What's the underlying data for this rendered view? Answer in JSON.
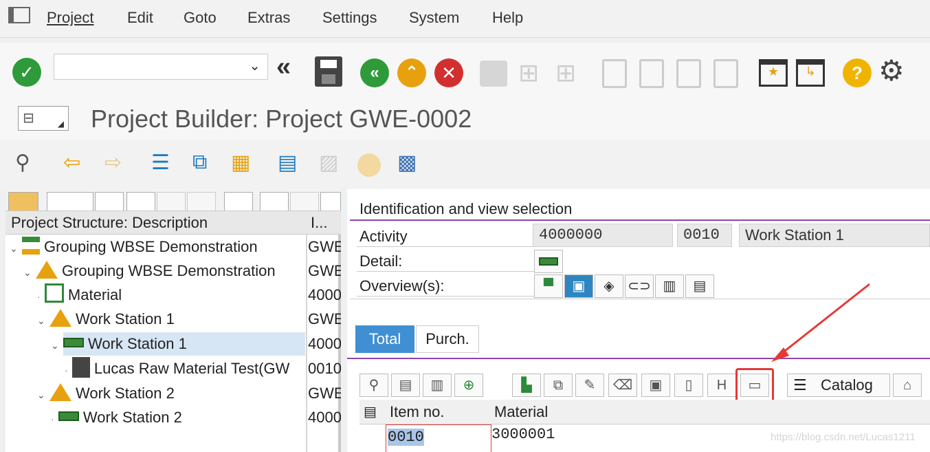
{
  "menu": {
    "project": "Project",
    "edit": "Edit",
    "goto": "Goto",
    "extras": "Extras",
    "settings": "Settings",
    "system": "System",
    "help": "Help"
  },
  "title": "Project Builder: Project GWE-0002",
  "tree": {
    "col1": "Project Structure: Description",
    "col2": "I...",
    "rows": [
      {
        "text": "Grouping WBSE Demonstration",
        "id": "GWE"
      },
      {
        "text": "Grouping WBSE Demonstration",
        "id": "GWE"
      },
      {
        "text": "Material",
        "id": "4000"
      },
      {
        "text": "Work Station 1",
        "id": "GWE"
      },
      {
        "text": "Work Station 1",
        "id": "4000"
      },
      {
        "text": "Lucas Raw Material Test(GW",
        "id": "0010"
      },
      {
        "text": "Work Station 2",
        "id": "GWE"
      },
      {
        "text": "Work Station 2",
        "id": "4000"
      }
    ]
  },
  "ident": {
    "heading": "Identification and view selection",
    "activity_label": "Activity",
    "activity_num": "4000000",
    "activity_op": "0010",
    "activity_desc": "Work Station 1",
    "detail_label": "Detail:",
    "overview_label": "Overview(s):"
  },
  "tabs": {
    "total": "Total",
    "purch": "Purch."
  },
  "catalog": "Catalog",
  "table": {
    "col_item": "Item no.",
    "col_material": "Material",
    "item": "0010",
    "material": "3000001"
  },
  "watermark": "https://blog.csdn.net/Lucas1211"
}
